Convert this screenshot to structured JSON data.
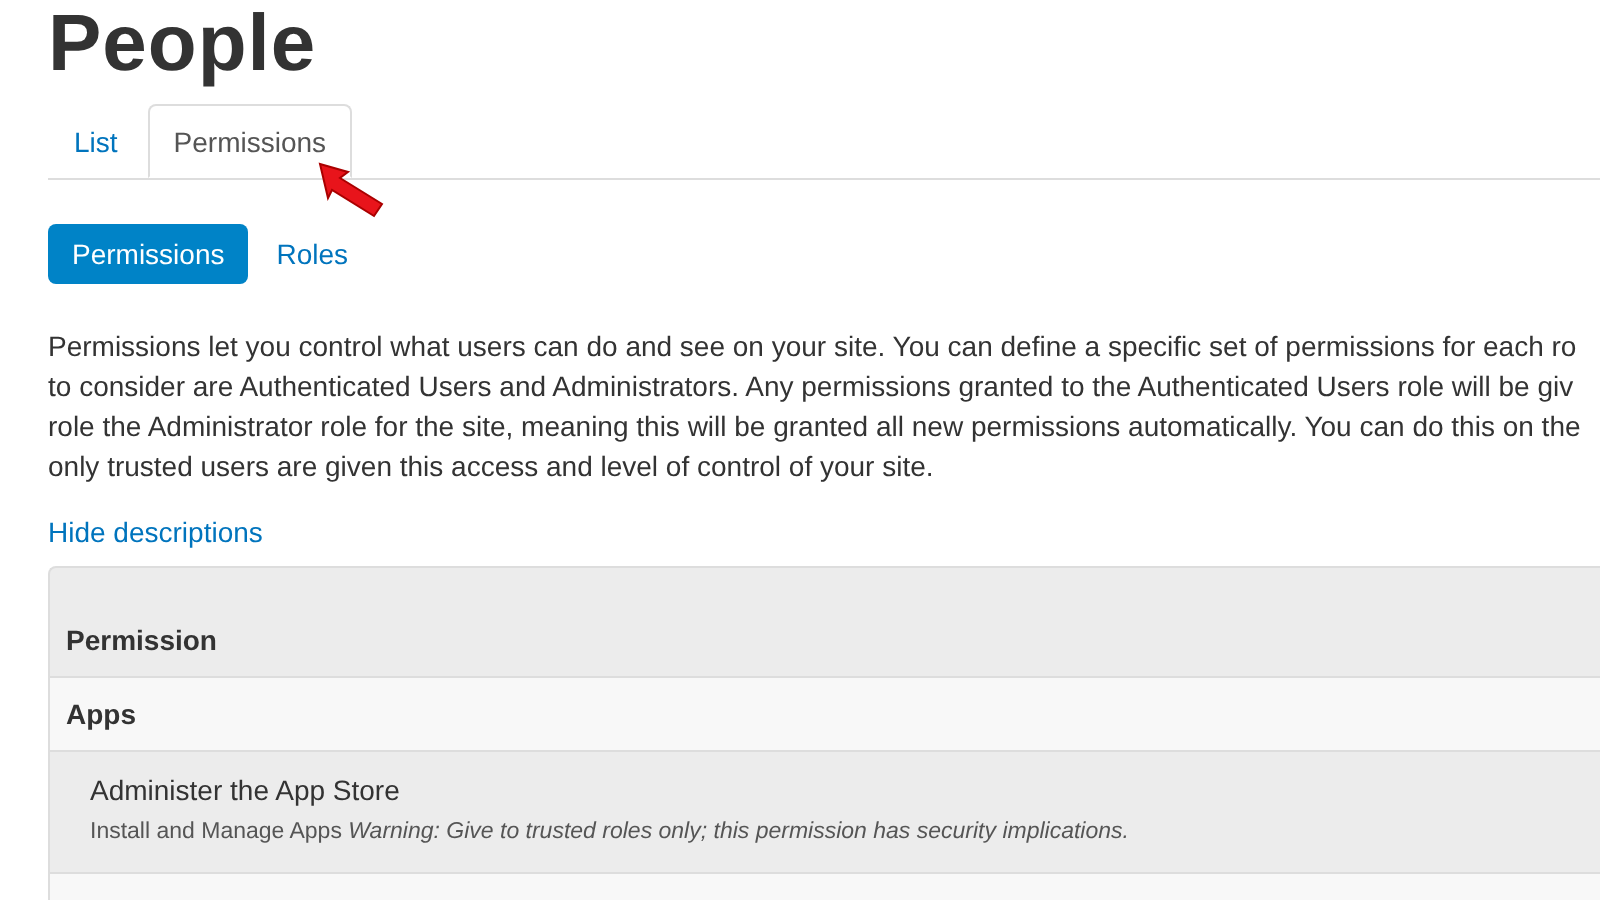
{
  "title": "People",
  "tabs": [
    {
      "label": "List",
      "selected": false
    },
    {
      "label": "Permissions",
      "selected": true
    }
  ],
  "pills": [
    {
      "label": "Permissions",
      "selected": true
    },
    {
      "label": "Roles",
      "selected": false
    }
  ],
  "description_lines": [
    "Permissions let you control what users can do and see on your site. You can define a specific set of permissions for each ro",
    "to consider are Authenticated Users and Administrators. Any permissions granted to the Authenticated Users role will be giv",
    "role the Administrator role for the site, meaning this will be granted all new permissions automatically. You can do this on the",
    "only trusted users are given this access and level of control of your site."
  ],
  "hide_link": "Hide descriptions",
  "table": {
    "columns": [
      "Permission"
    ],
    "groups": [
      {
        "name": "Apps",
        "rows": [
          {
            "title": "Administer the App Store",
            "description": "Install and Manage Apps *Warning: Give to trusted roles only; this permission has security implications.*"
          }
        ]
      }
    ]
  }
}
